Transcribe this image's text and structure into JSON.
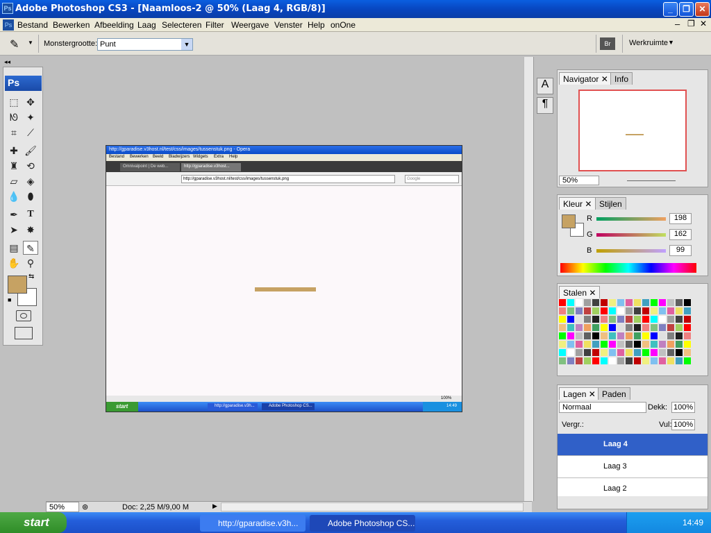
{
  "window": {
    "title": "Adobe Photoshop CS3 - [Naamloos-2 @ 50% (Laag 4, RGB/8)]"
  },
  "menu": [
    "Bestand",
    "Bewerken",
    "Afbeelding",
    "Laag",
    "Selecteren",
    "Filter",
    "Weergave",
    "Venster",
    "Help",
    "onOne"
  ],
  "options": {
    "sample_label": "Monstergrootte:",
    "sample_value": "Punt",
    "workspace_label": "Werkruimte"
  },
  "navigator": {
    "tabs": [
      "Navigator",
      "Info"
    ],
    "zoom": "50%"
  },
  "color": {
    "tabs": [
      "Kleur",
      "Stijlen"
    ],
    "r_label": "R",
    "g_label": "G",
    "b_label": "B",
    "r": "198",
    "g": "162",
    "b": "99",
    "fg": "#c6a263"
  },
  "swatches": {
    "tabs": [
      "Stalen"
    ]
  },
  "layers": {
    "tabs": [
      "Lagen",
      "Paden"
    ],
    "blend": "Normaal",
    "opacity_label": "Dekk:",
    "opacity": "100%",
    "lock_label": "Vergr.:",
    "fill_label": "Vul:",
    "fill": "100%",
    "items": [
      "Laag 4",
      "Laag 3",
      "Laag 2"
    ]
  },
  "status": {
    "zoom": "50%",
    "doc": "Doc: 2,25 M/9,00 M"
  },
  "embedded": {
    "title": "http://gparadise.v3host.nl/test/css/images/tussenstuk.png - Opera",
    "menu": [
      "Bestand",
      "Bewerken",
      "Beeld",
      "Bladwijzers",
      "Widgets",
      "Extra",
      "Help"
    ],
    "tab1": "Omnivalpoint | De web...",
    "tab2": "http://gparadise.v3host...",
    "address": "http://gparadise.v3host.nl/test/css/images/tussenstuk.png",
    "search": "Google",
    "zoom": "100%",
    "task1": "http://gparadise.v3h...",
    "task2": "Adobe Photoshop CS...",
    "start": "start",
    "clock": "14:49"
  },
  "taskbar": {
    "start": "start",
    "task1": "http://gparadise.v3h...",
    "task2": "Adobe Photoshop CS...",
    "clock": "14:49"
  }
}
